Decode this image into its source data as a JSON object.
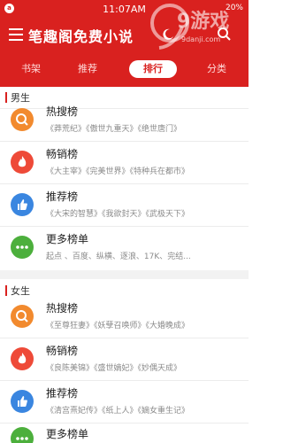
{
  "status_bar": {
    "time": "11:07AM",
    "right": "20%"
  },
  "app": {
    "title": "笔趣阁免费小说"
  },
  "watermark": {
    "brand": "9游戏",
    "site": "9danji.com"
  },
  "tabs": [
    {
      "label": "书架",
      "active": false
    },
    {
      "label": "推荐",
      "active": false
    },
    {
      "label": "排行",
      "active": true
    },
    {
      "label": "分类",
      "active": false
    }
  ],
  "sections": [
    {
      "label": "男生",
      "lists": [
        {
          "name": "热搜榜",
          "books": "《莽荒纪》《傲世九重天》《绝世唐门》",
          "icon": "search-icon",
          "color": "#f28a2e"
        },
        {
          "name": "畅销榜",
          "books": "《大主宰》《完美世界》《特种兵在都市》",
          "icon": "fire-icon",
          "color": "#ee4a38"
        },
        {
          "name": "推荐榜",
          "books": "《大宋的智慧》《我欲封天》《武极天下》",
          "icon": "thumbs-up-icon",
          "color": "#3a86e0"
        },
        {
          "name": "更多榜单",
          "books": "起点 、百度、纵横、逐浪、17K、完结...",
          "icon": "more-icon",
          "color": "#4caf3c"
        }
      ]
    },
    {
      "label": "女生",
      "lists": [
        {
          "name": "热搜榜",
          "books": "《至尊狂妻》《妖孽召唤师》《大婚晚成》",
          "icon": "search-icon",
          "color": "#f28a2e"
        },
        {
          "name": "畅销榜",
          "books": "《良陈美锦》《盛世嫡妃》《妙偶天成》",
          "icon": "fire-icon",
          "color": "#ee4a38"
        },
        {
          "name": "推荐榜",
          "books": "《清宫熹妃传》《纸上人》《嫡女重生记》",
          "icon": "thumbs-up-icon",
          "color": "#3a86e0"
        },
        {
          "name": "更多榜单",
          "books": "",
          "icon": "more-icon",
          "color": "#4caf3c"
        }
      ]
    }
  ]
}
